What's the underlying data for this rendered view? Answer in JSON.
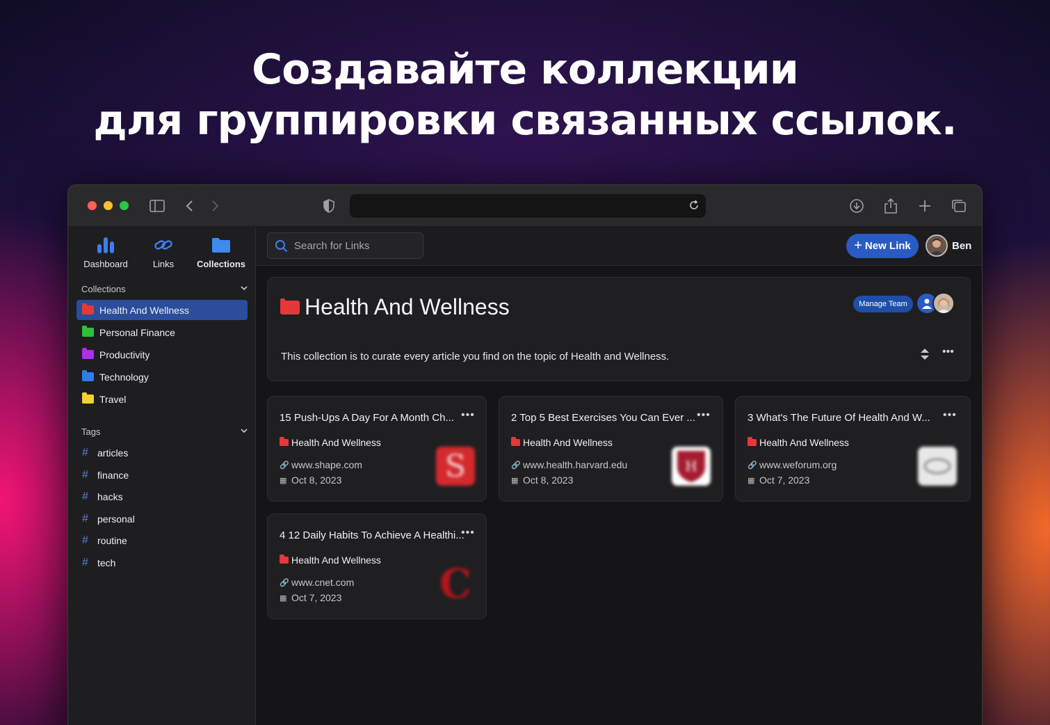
{
  "headline": {
    "line1": "Создавайте коллекции",
    "line2": "для группировки связанных ссылок."
  },
  "nav": {
    "dashboard": "Dashboard",
    "links": "Links",
    "collections": "Collections"
  },
  "sidebar": {
    "collections_header": "Collections",
    "collections": [
      {
        "label": "Health And Wellness",
        "color": "#e5383b"
      },
      {
        "label": "Personal Finance",
        "color": "#2fbf3a"
      },
      {
        "label": "Productivity",
        "color": "#b02ee8"
      },
      {
        "label": "Technology",
        "color": "#2f7de8"
      },
      {
        "label": "Travel",
        "color": "#f2d22e"
      }
    ],
    "tags_header": "Tags",
    "tags": [
      "articles",
      "finance",
      "hacks",
      "personal",
      "routine",
      "tech"
    ]
  },
  "topbar": {
    "search_placeholder": "Search for Links",
    "new_link": "New Link",
    "user_name": "Ben"
  },
  "collection": {
    "title": "Health And Wellness",
    "description": "This collection is to curate every article you find on the topic of Health and Wellness.",
    "manage_team": "Manage Team",
    "color": "#e5383b"
  },
  "links": [
    {
      "title": "15 Push-Ups A Day For A Month Ch...",
      "collection": "Health And Wellness",
      "url": "www.shape.com",
      "date": "Oct 8, 2023",
      "thumb_color": "#d42a2e",
      "thumb_letter": "S"
    },
    {
      "title": "2 Top 5 Best Exercises You Can Ever ...",
      "collection": "Health And Wellness",
      "url": "www.health.harvard.edu",
      "date": "Oct 8, 2023",
      "thumb_color": "#a51c30",
      "thumb_letter": "H"
    },
    {
      "title": "3 What's The Future Of Health And W...",
      "collection": "Health And Wellness",
      "url": "www.weforum.org",
      "date": "Oct 7, 2023",
      "thumb_color": "#e8e8e8",
      "thumb_letter": ""
    },
    {
      "title": "4 12 Daily Habits To Achieve A Healthi...",
      "collection": "Health And Wellness",
      "url": "www.cnet.com",
      "date": "Oct 7, 2023",
      "thumb_color": "#b3151c",
      "thumb_letter": "C"
    }
  ]
}
